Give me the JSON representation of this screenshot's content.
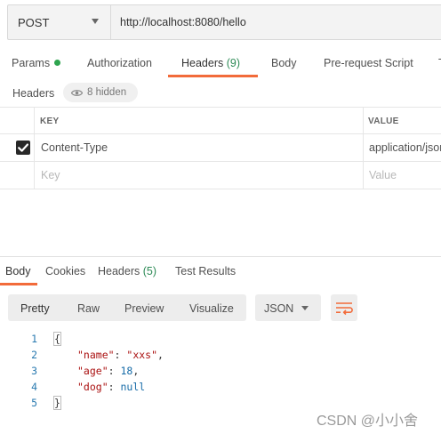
{
  "request": {
    "method": "POST",
    "url": "http://localhost:8080/hello"
  },
  "request_tabs": {
    "params": "Params",
    "authorization": "Authorization",
    "headers": "Headers",
    "headers_count": "(9)",
    "body": "Body",
    "prerequest": "Pre-request Script",
    "next_tab": "T"
  },
  "headers_section": {
    "label": "Headers",
    "hidden": "8 hidden"
  },
  "headers_table": {
    "col_key": "KEY",
    "col_value": "VALUE",
    "rows": [
      {
        "key": "Content-Type",
        "value": "application/json",
        "checked": true
      }
    ],
    "placeholder_key": "Key",
    "placeholder_value": "Value"
  },
  "response_tabs": {
    "body": "Body",
    "cookies": "Cookies",
    "headers": "Headers",
    "headers_count": "(5)",
    "test_results": "Test Results"
  },
  "format_bar": {
    "pretty": "Pretty",
    "raw": "Raw",
    "preview": "Preview",
    "visualize": "Visualize",
    "format": "JSON"
  },
  "code": {
    "line_numbers": [
      "1",
      "2",
      "3",
      "4",
      "5"
    ],
    "open_brace": "{",
    "close_brace": "}",
    "k1": "\"name\"",
    "v1": "\"xxs\"",
    "k2": "\"age\"",
    "v2": "18",
    "k3": "\"dog\"",
    "v3": "null"
  },
  "watermark": "CSDN @小小舍",
  "colors": {
    "accent": "#f26b3a",
    "status_green": "#2ea44f",
    "key_color": "#a11111",
    "number_color": "#186ca8"
  }
}
